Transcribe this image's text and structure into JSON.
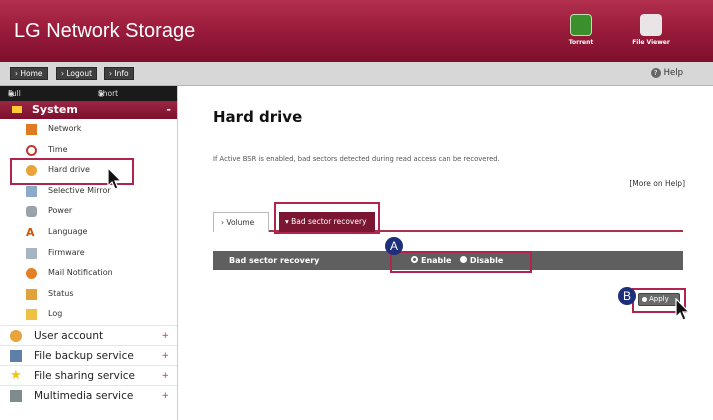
{
  "header": {
    "brand": "LG Network Storage",
    "apps": [
      {
        "label": "Torrent",
        "icon": "torrent-icon"
      },
      {
        "label": "File Viewer",
        "icon": "file-viewer-icon"
      }
    ]
  },
  "toolbar": {
    "buttons": [
      "Home",
      "Logout",
      "Info"
    ],
    "help": "Help"
  },
  "sidebar": {
    "tabs": [
      "Full Menu",
      "Short Menu"
    ],
    "system_title": "System",
    "system_items": [
      "Network",
      "Time",
      "Hard drive",
      "Selective Mirror",
      "Power",
      "Language",
      "Firmware",
      "Mail Notification",
      "Status",
      "Log"
    ],
    "categories": [
      "User account",
      "File backup service",
      "File sharing service",
      "Multimedia service"
    ]
  },
  "main": {
    "title": "Hard drive",
    "description": "If Active BSR is enabled, bad sectors detected during read access can be recovered.",
    "more_help": "[More on Help]",
    "tabs": [
      "Volume",
      "Bad sector recovery"
    ],
    "bsr_label": "Bad sector recovery",
    "enable": "Enable",
    "disable": "Disable",
    "apply": "Apply"
  },
  "annotations": {
    "a": "A",
    "b": "B"
  },
  "colors": {
    "accent": "#9c1c3c",
    "highlight": "#b0244e",
    "marker": "#1e2f7a"
  }
}
